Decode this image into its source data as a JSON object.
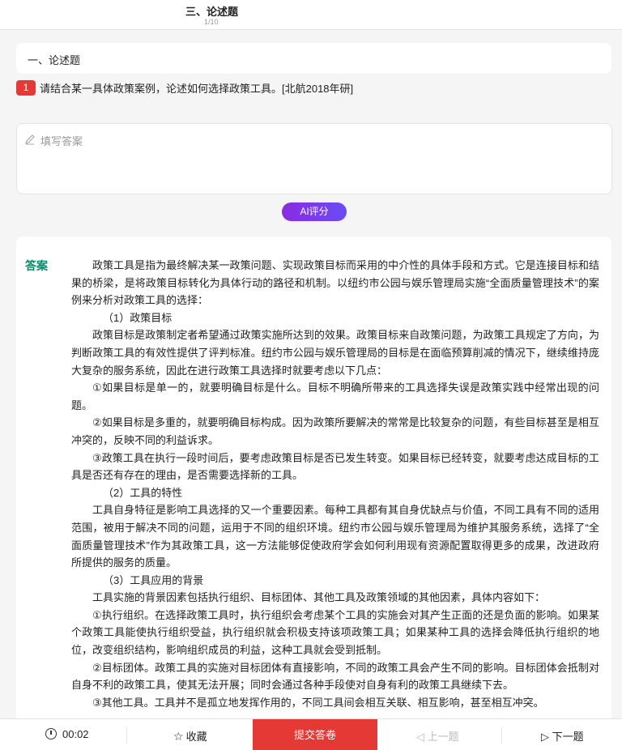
{
  "header": {
    "title": "三、论述题",
    "progress": "1/10"
  },
  "section": {
    "title": "一、论述题"
  },
  "question": {
    "number": "1",
    "text": "请结合某一具体政策案例，论述如何选择政策工具。[北航2018年研]"
  },
  "answer_input": {
    "placeholder": "填写答案"
  },
  "ai_button": {
    "label": "AI评分"
  },
  "answer": {
    "label": "答案",
    "paragraphs": [
      "政策工具是指为最终解决某一政策问题、实现政策目标而采用的中介性的具体手段和方式。它是连接目标和结果的桥梁，是将政策目标转化为具体行动的路径和机制。以纽约市公园与娱乐管理局实施“全面质量管理技术”的案例来分析对政策工具的选择：",
      "（1）政策目标",
      "政策目标是政策制定者希望通过政策实施所达到的效果。政策目标来自政策问题，为政策工具规定了方向，为判断政策工具的有效性提供了评判标准。纽约市公园与娱乐管理局的目标是在面临预算削减的情况下，继续维持庞大复杂的服务系统，因此在进行政策工具选择时就要考虑以下几点：",
      "①如果目标是单一的，就要明确目标是什么。目标不明确所带来的工具选择失误是政策实践中经常出现的问题。",
      "②如果目标是多重的，就要明确目标构成。因为政策所要解决的常常是比较复杂的问题，有些目标甚至是相互冲突的，反映不同的利益诉求。",
      "③政策工具在执行一段时间后，要考虑政策目标是否已发生转变。如果目标已经转变，就要考虑达成目标的工具是否还有存在的理由，是否需要选择新的工具。",
      "（2）工具的特性",
      "工具自身特征是影响工具选择的又一个重要因素。每种工具都有其自身优缺点与价值，不同工具有不同的适用范围，被用于解决不同的问题，运用于不同的组织环境。纽约市公园与娱乐管理局为维护其服务系统，选择了“全面质量管理技术”作为其政策工具，这一方法能够促使政府学会如何利用现有资源配置取得更多的成果，改进政府所提供的服务的质量。",
      "（3）工具应用的背景",
      "工具实施的背景因素包括执行组织、目标团体、其他工具及政策领域的其他因素，具体内容如下：",
      "①执行组织。在选择政策工具时，执行组织会考虑某个工具的实施会对其产生正面的还是负面的影响。如果某个政策工具能使执行组织受益，执行组织就会积极支持该项政策工具；如果某种工具的选择会降低执行组织的地位，改变组织结构，影响组织成员的利益，这种工具就会受到抵制。",
      "②目标团体。政策工具的实施对目标团体有直接影响，不同的政策工具会产生不同的影响。目标团体会抵制对自身不利的政策工具，使其无法开展；同时会通过各种手段使对自身有利的政策工具继续下去。",
      "③其他工具。工具并不是孤立地发挥作用的，不同工具间会相互关联、相互影响，甚至相互冲突。"
    ]
  },
  "bottom": {
    "timer": "00:02",
    "favorite": "收藏",
    "submit": "提交答卷",
    "prev": "上一题",
    "next": "下一题"
  }
}
